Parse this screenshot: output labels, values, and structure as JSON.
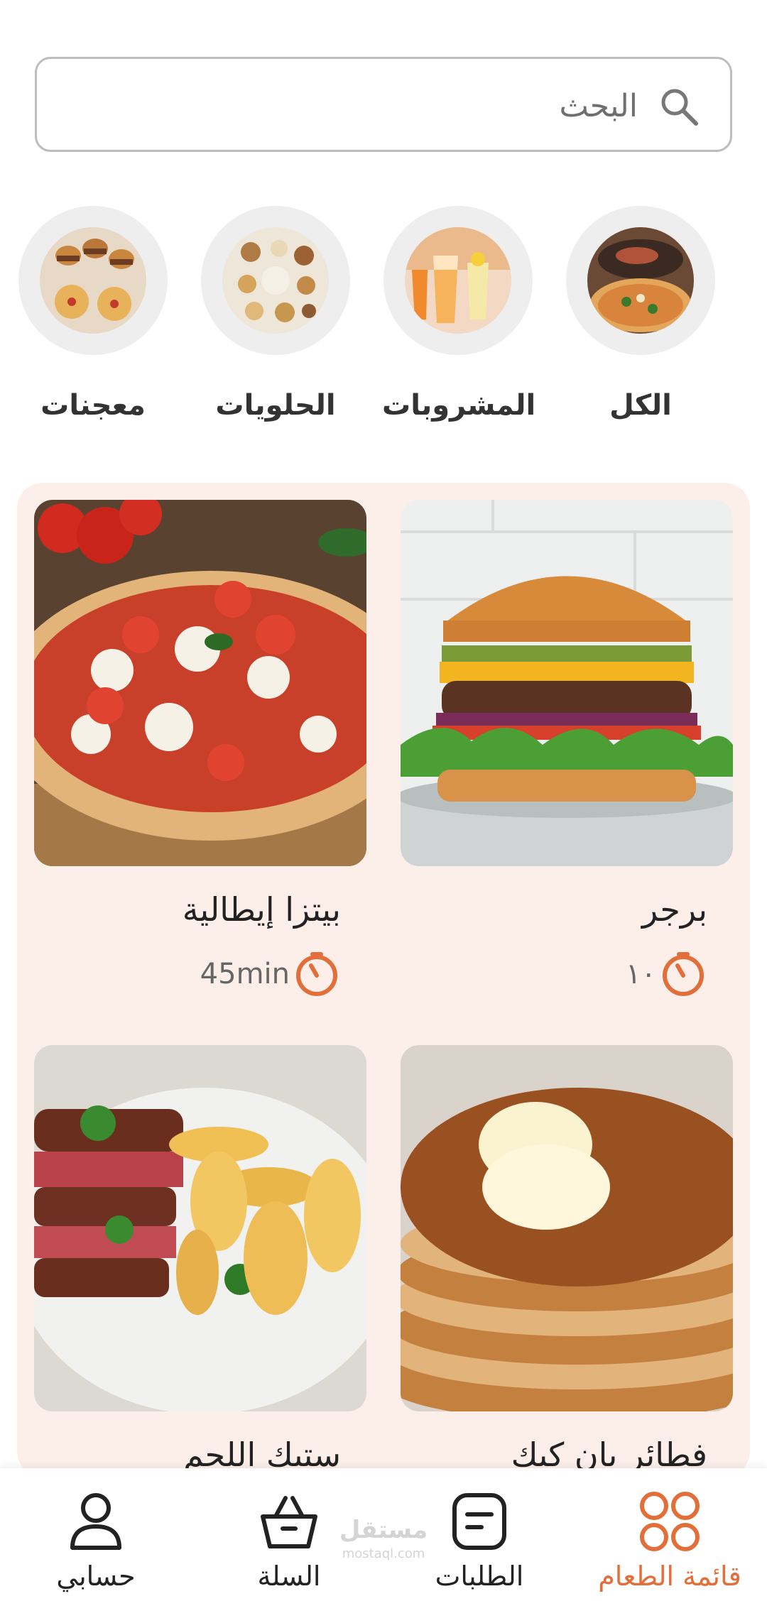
{
  "search": {
    "placeholder": "البحث",
    "icon": "search-icon"
  },
  "categories": [
    {
      "label": "الكل",
      "icon": "pizza-grill-image"
    },
    {
      "label": "المشروبات",
      "icon": "drinks-image"
    },
    {
      "label": "الحلويات",
      "icon": "sweets-image"
    },
    {
      "label": "معجنات",
      "icon": "pastries-image"
    }
  ],
  "products": [
    {
      "title": "برجر",
      "time": "١٠",
      "image": "burger-image"
    },
    {
      "title": "بيتزا إيطالية",
      "time": "45min",
      "image": "pizza-image"
    },
    {
      "title": "فطائر بان كيك",
      "time": "",
      "image": "pancakes-image"
    },
    {
      "title": "ستيك اللحم",
      "time": "",
      "image": "steak-image"
    }
  ],
  "nav": {
    "menu": "قائمة الطعام",
    "orders": "الطلبات",
    "cart": "السلة",
    "account": "حسابي"
  },
  "watermark": {
    "main": "مستقل",
    "sub": "mostaql.com"
  },
  "colors": {
    "accent": "#e26f3a",
    "panel": "#fcefea",
    "border": "#bdbdbd"
  }
}
